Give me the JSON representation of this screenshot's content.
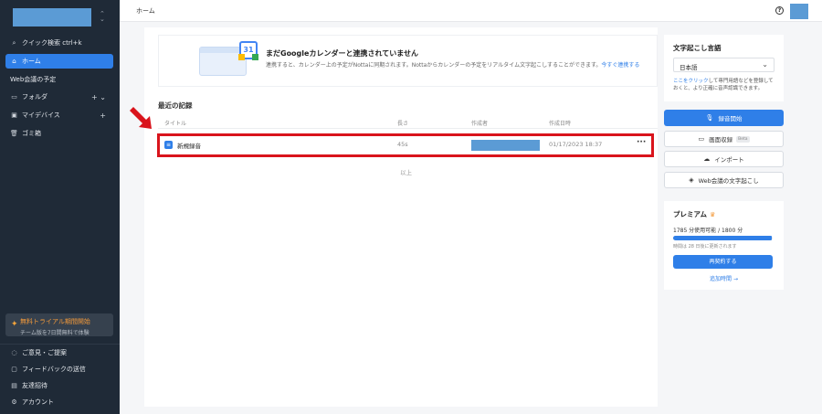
{
  "sidebar": {
    "quick_search": "クイック検索 ctrl+k",
    "items": [
      {
        "label": "ホーム",
        "active": true
      },
      {
        "label": "Web会議の予定"
      },
      {
        "label": "フォルダ"
      },
      {
        "label": "マイデバイス"
      },
      {
        "label": "ゴミ箱"
      }
    ],
    "trial": {
      "title": "無料トライアル期間開始",
      "subtitle": "チーム版を7日間無料で体験"
    },
    "bottom": [
      {
        "label": "ご意見・ご提案"
      },
      {
        "label": "フィードバックの送信"
      },
      {
        "label": "友達招待"
      },
      {
        "label": "アカウント"
      }
    ]
  },
  "header": {
    "breadcrumb": "ホーム"
  },
  "banner": {
    "title": "まだGoogleカレンダーと連携されていません",
    "desc": "連携すると、カレンダー上の予定がNottaに同期されます。Nottaからカレンダーの予定をリアルタイム文字起こしすることができます。",
    "link": "今すぐ連携する"
  },
  "recent": {
    "title": "最近の記録",
    "columns": {
      "title": "タイトル",
      "length": "長さ",
      "author": "作成者",
      "created": "作成日時"
    },
    "rows": [
      {
        "name": "新規録音",
        "length": "45s",
        "date": "01/17/2023 18:37"
      }
    ],
    "end_label": "以上"
  },
  "transcription": {
    "title": "文字起こし言語",
    "language": "日本語",
    "note_link": "ここをクリック",
    "note": "して専門用語などを登録しておくと、より正確に音声認識できます。"
  },
  "actions": {
    "record": "録音開始",
    "screen_record": "画面収録",
    "beta": "Beta",
    "import": "インポート",
    "web_meeting": "Web会議の文字起こし"
  },
  "premium": {
    "title": "プレミアム",
    "usage": "1785 分使用可能 / 1800 分",
    "usage_fraction": 0.99,
    "update_note": "時間は 28 日後に更新されます",
    "renew": "再契約する",
    "add_time": "追加時間 →"
  },
  "colors": {
    "accent": "#2f7fe8",
    "sidebar_bg": "#1f2a37",
    "highlight": "#d9141c"
  }
}
